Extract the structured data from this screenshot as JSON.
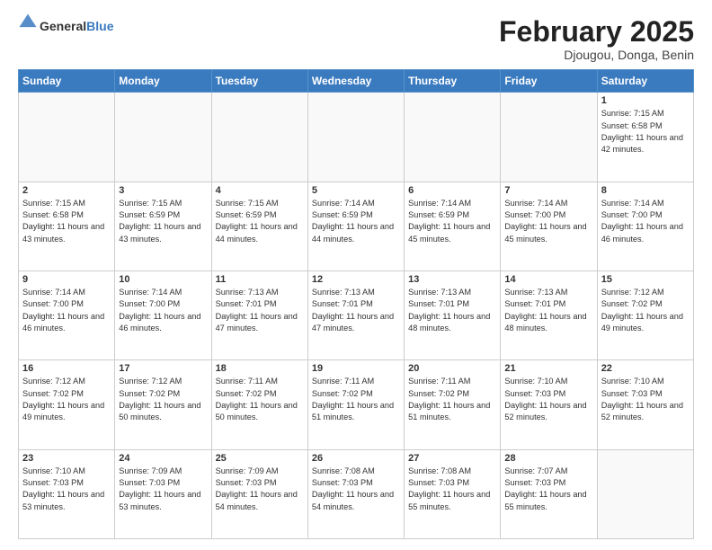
{
  "header": {
    "logo_general": "General",
    "logo_blue": "Blue",
    "month_title": "February 2025",
    "location": "Djougou, Donga, Benin"
  },
  "days_of_week": [
    "Sunday",
    "Monday",
    "Tuesday",
    "Wednesday",
    "Thursday",
    "Friday",
    "Saturday"
  ],
  "weeks": [
    [
      {
        "day": "",
        "empty": true
      },
      {
        "day": "",
        "empty": true
      },
      {
        "day": "",
        "empty": true
      },
      {
        "day": "",
        "empty": true
      },
      {
        "day": "",
        "empty": true
      },
      {
        "day": "",
        "empty": true
      },
      {
        "day": "1",
        "sunrise": "7:15 AM",
        "sunset": "6:58 PM",
        "daylight": "11 hours and 42 minutes."
      }
    ],
    [
      {
        "day": "2",
        "sunrise": "7:15 AM",
        "sunset": "6:58 PM",
        "daylight": "11 hours and 43 minutes."
      },
      {
        "day": "3",
        "sunrise": "7:15 AM",
        "sunset": "6:59 PM",
        "daylight": "11 hours and 43 minutes."
      },
      {
        "day": "4",
        "sunrise": "7:15 AM",
        "sunset": "6:59 PM",
        "daylight": "11 hours and 44 minutes."
      },
      {
        "day": "5",
        "sunrise": "7:14 AM",
        "sunset": "6:59 PM",
        "daylight": "11 hours and 44 minutes."
      },
      {
        "day": "6",
        "sunrise": "7:14 AM",
        "sunset": "6:59 PM",
        "daylight": "11 hours and 45 minutes."
      },
      {
        "day": "7",
        "sunrise": "7:14 AM",
        "sunset": "7:00 PM",
        "daylight": "11 hours and 45 minutes."
      },
      {
        "day": "8",
        "sunrise": "7:14 AM",
        "sunset": "7:00 PM",
        "daylight": "11 hours and 46 minutes."
      }
    ],
    [
      {
        "day": "9",
        "sunrise": "7:14 AM",
        "sunset": "7:00 PM",
        "daylight": "11 hours and 46 minutes."
      },
      {
        "day": "10",
        "sunrise": "7:14 AM",
        "sunset": "7:00 PM",
        "daylight": "11 hours and 46 minutes."
      },
      {
        "day": "11",
        "sunrise": "7:13 AM",
        "sunset": "7:01 PM",
        "daylight": "11 hours and 47 minutes."
      },
      {
        "day": "12",
        "sunrise": "7:13 AM",
        "sunset": "7:01 PM",
        "daylight": "11 hours and 47 minutes."
      },
      {
        "day": "13",
        "sunrise": "7:13 AM",
        "sunset": "7:01 PM",
        "daylight": "11 hours and 48 minutes."
      },
      {
        "day": "14",
        "sunrise": "7:13 AM",
        "sunset": "7:01 PM",
        "daylight": "11 hours and 48 minutes."
      },
      {
        "day": "15",
        "sunrise": "7:12 AM",
        "sunset": "7:02 PM",
        "daylight": "11 hours and 49 minutes."
      }
    ],
    [
      {
        "day": "16",
        "sunrise": "7:12 AM",
        "sunset": "7:02 PM",
        "daylight": "11 hours and 49 minutes."
      },
      {
        "day": "17",
        "sunrise": "7:12 AM",
        "sunset": "7:02 PM",
        "daylight": "11 hours and 50 minutes."
      },
      {
        "day": "18",
        "sunrise": "7:11 AM",
        "sunset": "7:02 PM",
        "daylight": "11 hours and 50 minutes."
      },
      {
        "day": "19",
        "sunrise": "7:11 AM",
        "sunset": "7:02 PM",
        "daylight": "11 hours and 51 minutes."
      },
      {
        "day": "20",
        "sunrise": "7:11 AM",
        "sunset": "7:02 PM",
        "daylight": "11 hours and 51 minutes."
      },
      {
        "day": "21",
        "sunrise": "7:10 AM",
        "sunset": "7:03 PM",
        "daylight": "11 hours and 52 minutes."
      },
      {
        "day": "22",
        "sunrise": "7:10 AM",
        "sunset": "7:03 PM",
        "daylight": "11 hours and 52 minutes."
      }
    ],
    [
      {
        "day": "23",
        "sunrise": "7:10 AM",
        "sunset": "7:03 PM",
        "daylight": "11 hours and 53 minutes."
      },
      {
        "day": "24",
        "sunrise": "7:09 AM",
        "sunset": "7:03 PM",
        "daylight": "11 hours and 53 minutes."
      },
      {
        "day": "25",
        "sunrise": "7:09 AM",
        "sunset": "7:03 PM",
        "daylight": "11 hours and 54 minutes."
      },
      {
        "day": "26",
        "sunrise": "7:08 AM",
        "sunset": "7:03 PM",
        "daylight": "11 hours and 54 minutes."
      },
      {
        "day": "27",
        "sunrise": "7:08 AM",
        "sunset": "7:03 PM",
        "daylight": "11 hours and 55 minutes."
      },
      {
        "day": "28",
        "sunrise": "7:07 AM",
        "sunset": "7:03 PM",
        "daylight": "11 hours and 55 minutes."
      },
      {
        "day": "",
        "empty": true
      }
    ]
  ]
}
